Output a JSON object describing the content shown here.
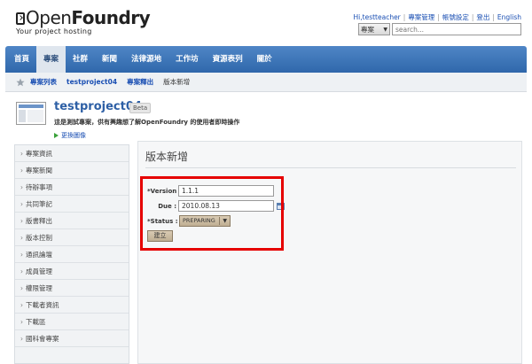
{
  "logo": {
    "open": "Open",
    "foundry": "Foundry",
    "tagline": "Your project hosting"
  },
  "toplinks": [
    "Hi,testteacher",
    "專案管理",
    "帳號設定",
    "登出",
    "English"
  ],
  "search": {
    "category": "專案",
    "placeholder": "search..."
  },
  "nav": [
    "首頁",
    "專案",
    "社群",
    "新聞",
    "法律源地",
    "工作坊",
    "資源表列",
    "關於"
  ],
  "breadcrumb": {
    "items": [
      "專案列表",
      "testproject04",
      "專案釋出"
    ],
    "current": "版本新增"
  },
  "project": {
    "name": "testproject04",
    "badge": "Beta",
    "description": "這是測試專案，供有興趣想了解OpenFoundry 的使用者即時操作",
    "change_image": "更換圖像"
  },
  "sidebar": [
    "專案資訊",
    "專案新聞",
    "待辦事項",
    "共同筆記",
    "版書釋出",
    "版本控制",
    "通訊論壇",
    "成員管理",
    "權限管理",
    "下載者資訊",
    "下載區",
    "國科會專案"
  ],
  "main": {
    "title": "版本新增",
    "form": {
      "version_label": "*Version :",
      "version_value": "1.1.1",
      "due_label": "Due :",
      "due_value": "2010.08.13",
      "status_label": "*Status :",
      "status_value": "PREPARING",
      "submit_label": "建立"
    }
  },
  "colors": {
    "nav": "#3a72b8",
    "highlight": "#e60000",
    "link": "#1a4fb3"
  }
}
